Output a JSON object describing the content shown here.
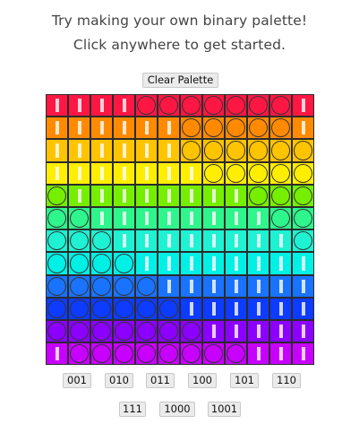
{
  "header": {
    "line1": "Try making your own binary palette!",
    "line2": "Click anywhere to get started."
  },
  "clear_button": "Clear Palette",
  "pattern_buttons": [
    "001",
    "010",
    "011",
    "100",
    "101",
    "110",
    "111",
    "1000",
    "1001"
  ],
  "palette": {
    "row_colors": [
      "#ff1744",
      "#ff8a00",
      "#ffc400",
      "#ffee00",
      "#76ee00",
      "#2ef58c",
      "#1ef2d2",
      "#00f0e6",
      "#1a73ff",
      "#0d3bff",
      "#8c00ff",
      "#c800ff"
    ],
    "rows": [
      "111100000001",
      "111111000001",
      "111111000000",
      "111111100000",
      "011111111000",
      "001111111100",
      "000111111110",
      "000011111111",
      "000001111111",
      "000000111111",
      "000000011111",
      "100000000111"
    ]
  }
}
